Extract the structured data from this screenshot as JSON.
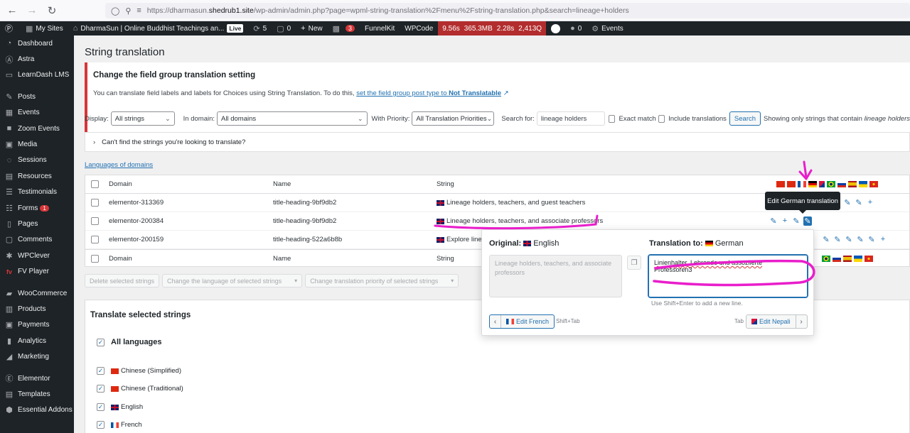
{
  "browser": {
    "url_prefix": "https://dharmasun.",
    "url_domain": "shedrub1.site",
    "url_path": "/wp-admin/admin.php?page=wpml-string-translation%2Fmenu%2Fstring-translation.php&search=lineage+holders"
  },
  "adminbar": {
    "my_sites": "My Sites",
    "site_name": "DharmaSun | Online Buddhist Teachings an...",
    "live": "Live",
    "updates": "5",
    "comments": "0",
    "new": "New",
    "notifications": "3",
    "funnelkit": "FunnelKit",
    "wpcode": "WPCode",
    "perf": [
      "9.56s",
      "365.3MB",
      "2.28s",
      "2,413Q"
    ],
    "count_zero": "0",
    "events": "Events"
  },
  "sidebar": {
    "items": [
      {
        "label": "Dashboard",
        "icon": "dashboard-icon"
      },
      {
        "label": "Astra",
        "icon": "astra-icon"
      },
      {
        "label": "LearnDash LMS",
        "icon": "learndash-icon"
      },
      {
        "label": "Posts",
        "icon": "pin-icon"
      },
      {
        "label": "Events",
        "icon": "calendar-icon"
      },
      {
        "label": "Zoom Events",
        "icon": "video-icon"
      },
      {
        "label": "Media",
        "icon": "media-icon"
      },
      {
        "label": "Sessions",
        "icon": "sessions-icon"
      },
      {
        "label": "Resources",
        "icon": "resources-icon"
      },
      {
        "label": "Testimonials",
        "icon": "testimonials-icon"
      },
      {
        "label": "Forms",
        "icon": "forms-icon",
        "badge": "1"
      },
      {
        "label": "Pages",
        "icon": "pages-icon"
      },
      {
        "label": "Comments",
        "icon": "comments-icon"
      },
      {
        "label": "WPClever",
        "icon": "wpclever-icon"
      },
      {
        "label": "FV Player",
        "icon": "fv-icon"
      },
      {
        "label": "WooCommerce",
        "icon": "woo-icon"
      },
      {
        "label": "Products",
        "icon": "products-icon"
      },
      {
        "label": "Payments",
        "icon": "payments-icon"
      },
      {
        "label": "Analytics",
        "icon": "analytics-icon"
      },
      {
        "label": "Marketing",
        "icon": "marketing-icon"
      },
      {
        "label": "Elementor",
        "icon": "elementor-icon"
      },
      {
        "label": "Templates",
        "icon": "templates-icon"
      },
      {
        "label": "Essential Addons",
        "icon": "addons-icon"
      }
    ]
  },
  "page": {
    "title": "String translation"
  },
  "notice": {
    "title": "Change the field group translation setting",
    "text": "You can translate field labels and labels for Choices using String Translation. To do this, ",
    "link_text": "set the field group post type to ",
    "link_bold": "Not Translatable"
  },
  "filters": {
    "display_label": "Display:",
    "display_value": "All strings",
    "domain_label": "In domain:",
    "domain_value": "All domains",
    "priority_label": "With Priority:",
    "priority_value": "All Translation Priorities",
    "search_label": "Search for:",
    "search_value": "lineage holders",
    "exact_match": "Exact match",
    "include_translations": "Include translations",
    "search_button": "Search",
    "showing_text": "Showing only strings that contain ",
    "showing_term": "lineage holders"
  },
  "cantfind": "Can't find the strings you're looking to translate?",
  "languages_link": "Languages of domains",
  "table": {
    "col_domain": "Domain",
    "col_name": "Name",
    "col_string": "String",
    "rows": [
      {
        "domain": "elementor-313369",
        "name": "title-heading-9bf9db2",
        "string": "Lineage holders, teachers, and guest teachers"
      },
      {
        "domain": "elementor-200384",
        "name": "title-heading-9bf9db2",
        "string": "Lineage holders, teachers, and associate professors"
      },
      {
        "domain": "elementor-200159",
        "name": "title-heading-522a6b8b",
        "string": "Explore lineag"
      }
    ]
  },
  "bulk": {
    "delete": "Delete selected strings",
    "change_language": "Change the language of selected strings",
    "change_priority": "Change translation priority of selected strings"
  },
  "translate_section": {
    "title": "Translate selected strings",
    "all_languages": "All languages",
    "languages": [
      "Chinese (Simplified)",
      "Chinese (Traditional)",
      "English",
      "French"
    ]
  },
  "tooltip": "Edit German translation",
  "popup": {
    "original_label": "Original:",
    "original_lang": "English",
    "original_text": "Lineage holders, teachers, and associate professors",
    "translation_label": "Translation to:",
    "translation_lang": "German",
    "translation_misspelled": "Linienhalter, Lehrende und assoziierte",
    "translation_rest": " Professoren3",
    "hint": "Use Shift+Enter to add a new line.",
    "prev_button": "Edit French",
    "prev_shortcut": "Shift+Tab",
    "next_shortcut": "Tab",
    "next_button": "Edit Nepali"
  },
  "colors": {
    "accent": "#2271b1",
    "adminbar": "#1d2327",
    "notice_border": "#d63638",
    "annotation": "#e91ecb"
  }
}
